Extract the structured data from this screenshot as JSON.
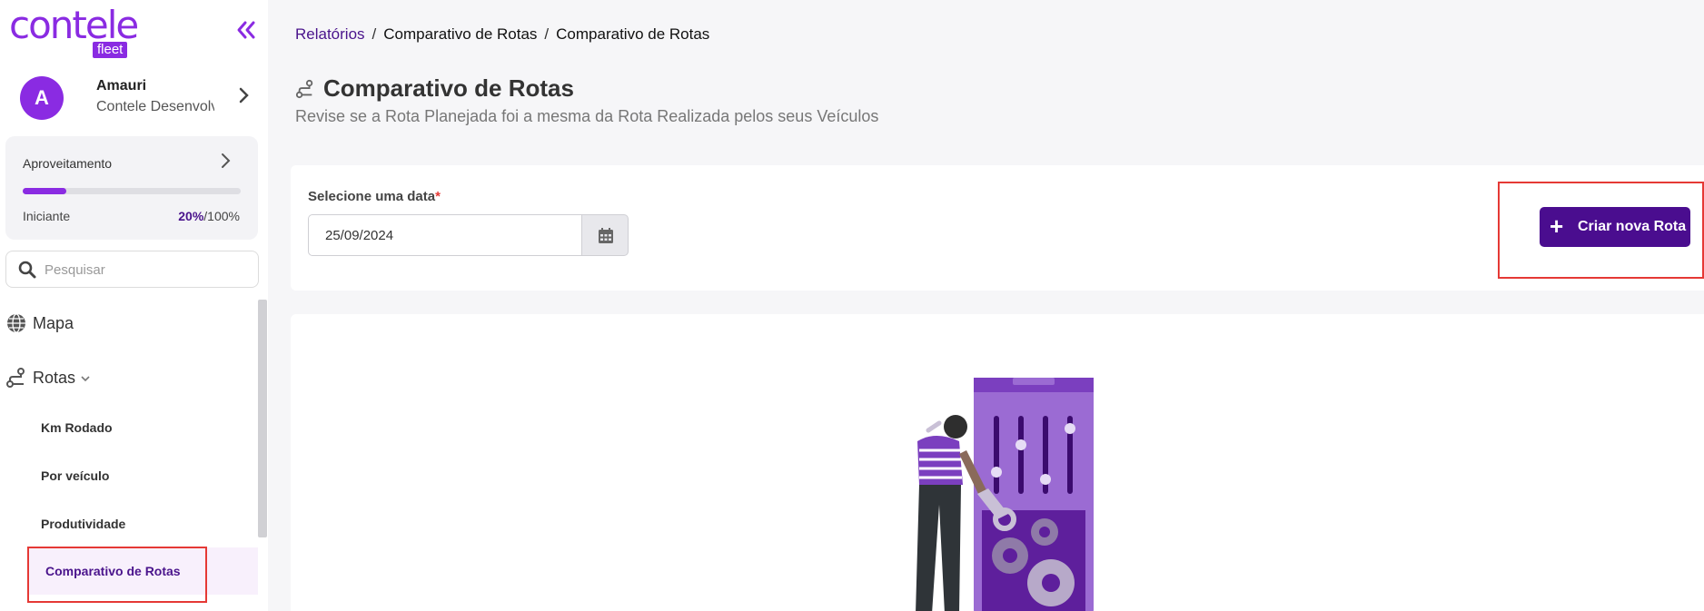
{
  "sidebar": {
    "logo": {
      "main": "contele",
      "sub": "fleet"
    },
    "user": {
      "initial": "A",
      "name": "Amauri",
      "company": "Contele Desenvolvimento"
    },
    "progress": {
      "title": "Aproveitamento",
      "level": "Iniciante",
      "percent": "20%",
      "total": "/100%",
      "value": 0.2
    },
    "search": {
      "placeholder": "Pesquisar"
    },
    "nav": {
      "map_label": "Mapa",
      "routes_label": "Rotas",
      "sub_items": [
        "Km Rodado",
        "Por veículo",
        "Produtividade",
        "Comparativo de Rotas"
      ]
    }
  },
  "breadcrumb": [
    "Relatórios",
    "Comparativo de Rotas",
    "Comparativo de Rotas"
  ],
  "page": {
    "title": "Comparativo de Rotas",
    "subtitle": "Revise se a Rota Planejada foi a mesma da Rota Realizada pelos seus Veículos"
  },
  "filter": {
    "date_label": "Selecione uma data",
    "required_mark": "*",
    "date_value": "25/09/2024",
    "new_route_label": "Criar nova Rota"
  },
  "colors": {
    "brand": "#8a2be2",
    "primary_dark": "#4a0d8f",
    "highlight": "#e53935"
  },
  "icons": [
    "collapse-icon",
    "chevron-right-icon",
    "search-icon",
    "globe-icon",
    "route-icon",
    "chevron-down-icon",
    "calendar-icon",
    "plus-icon"
  ]
}
